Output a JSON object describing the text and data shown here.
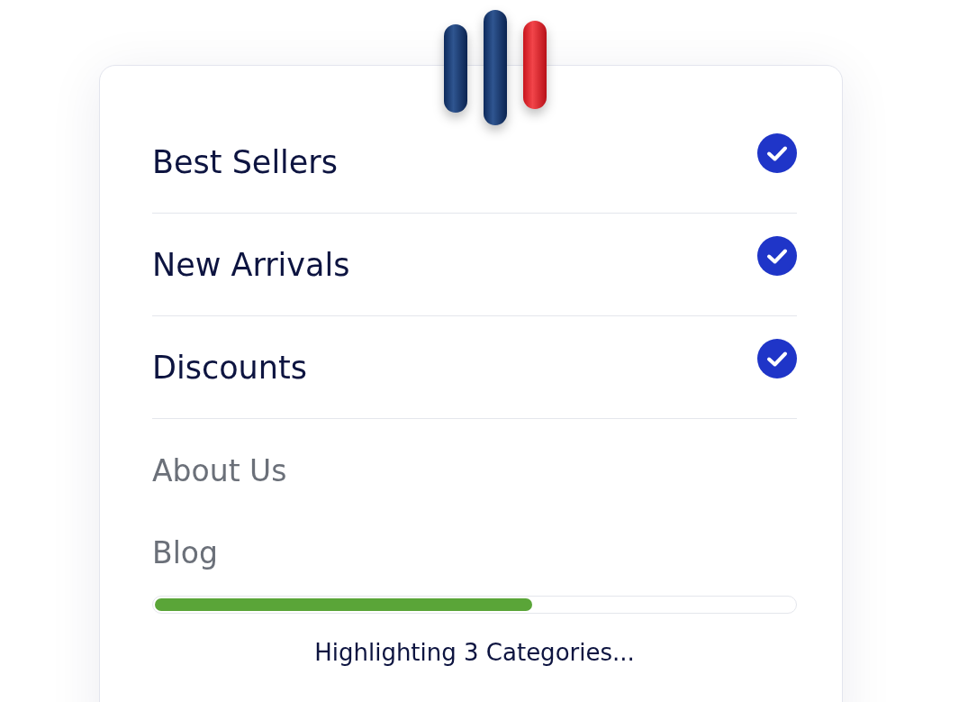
{
  "categories": [
    {
      "label": "Best Sellers",
      "checked": true
    },
    {
      "label": "New Arrivals",
      "checked": true
    },
    {
      "label": "Discounts",
      "checked": true
    },
    {
      "label": "About Us",
      "checked": false
    },
    {
      "label": "Blog",
      "checked": false
    }
  ],
  "progress": {
    "level": 0.59,
    "status": "Highlighting 3 Categories..."
  }
}
